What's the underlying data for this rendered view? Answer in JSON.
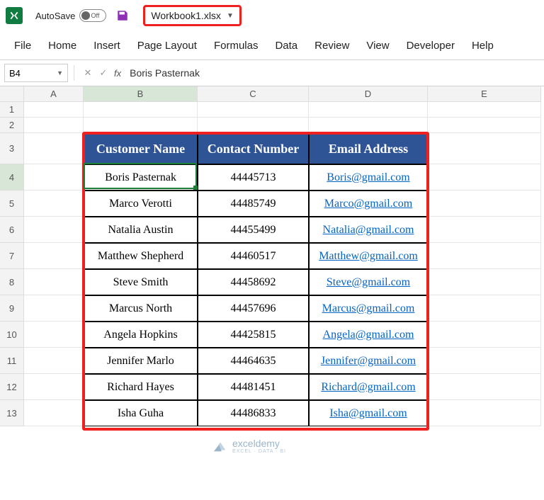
{
  "titlebar": {
    "autosave_label": "AutoSave",
    "autosave_state": "Off",
    "filename": "Workbook1.xlsx"
  },
  "ribbon": {
    "tabs": [
      "File",
      "Home",
      "Insert",
      "Page Layout",
      "Formulas",
      "Data",
      "Review",
      "View",
      "Developer",
      "Help"
    ]
  },
  "namebox": "B4",
  "formula": "Boris Pasternak",
  "columns": [
    "A",
    "B",
    "C",
    "D",
    "E"
  ],
  "rows": [
    "1",
    "2",
    "3",
    "4",
    "5",
    "6",
    "7",
    "8",
    "9",
    "10",
    "11",
    "12",
    "13"
  ],
  "selected_column": "B",
  "selected_row": "4",
  "table": {
    "headers": [
      "Customer Name",
      "Contact Number",
      "Email Address"
    ],
    "rows": [
      {
        "name": "Boris Pasternak",
        "contact": "44445713",
        "email": "Boris@gmail.com"
      },
      {
        "name": "Marco Verotti",
        "contact": "44485749",
        "email": "Marco@gmail.com"
      },
      {
        "name": "Natalia Austin",
        "contact": "44455499",
        "email": "Natalia@gmail.com"
      },
      {
        "name": "Matthew Shepherd",
        "contact": "44460517",
        "email": "Matthew@gmail.com"
      },
      {
        "name": "Steve Smith",
        "contact": "44458692",
        "email": "Steve@gmail.com"
      },
      {
        "name": "Marcus North",
        "contact": "44457696",
        "email": "Marcus@gmail.com"
      },
      {
        "name": "Angela Hopkins",
        "contact": "44425815",
        "email": "Angela@gmail.com"
      },
      {
        "name": "Jennifer Marlo",
        "contact": "44464635",
        "email": "Jennifer@gmail.com"
      },
      {
        "name": "Richard Hayes",
        "contact": "44481451",
        "email": "Richard@gmail.com"
      },
      {
        "name": "Isha Guha",
        "contact": "44486833",
        "email": "Isha@gmail.com"
      }
    ]
  },
  "watermark": {
    "brand": "exceldemy",
    "tag": "EXCEL · DATA · BI"
  }
}
